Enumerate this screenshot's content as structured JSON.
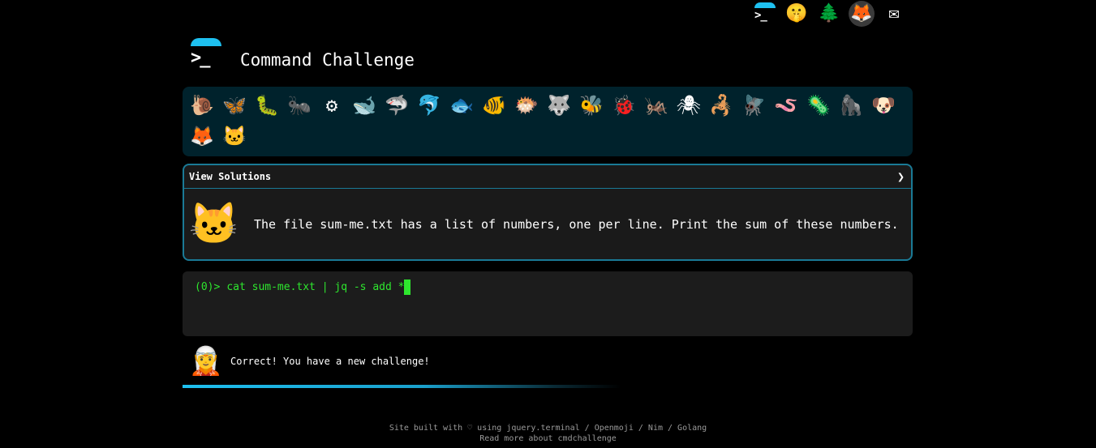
{
  "top_icons": [
    {
      "name": "cmd-logo-icon",
      "glyph": ">_"
    },
    {
      "name": "shushing-face-icon",
      "glyph": "🤫"
    },
    {
      "name": "tree-icon",
      "glyph": "🌲"
    },
    {
      "name": "gitlab-icon",
      "glyph": "🦊"
    },
    {
      "name": "mail-icon",
      "glyph": "✉"
    }
  ],
  "header": {
    "title": "Command Challenge",
    "logo_prompt": ">_"
  },
  "challenge_icons": [
    {
      "name": "snail-icon",
      "glyph": "🐌"
    },
    {
      "name": "butterfly-icon",
      "glyph": "🦋"
    },
    {
      "name": "caterpillar-icon",
      "glyph": "🐛"
    },
    {
      "name": "ant-icon",
      "glyph": "🐜"
    },
    {
      "name": "wheel-icon",
      "glyph": "⚙"
    },
    {
      "name": "whale-icon",
      "glyph": "🐋"
    },
    {
      "name": "shark-icon",
      "glyph": "🦈"
    },
    {
      "name": "dolphin-icon",
      "glyph": "🐬"
    },
    {
      "name": "fish-icon",
      "glyph": "🐟"
    },
    {
      "name": "tropical-fish-icon",
      "glyph": "🐠"
    },
    {
      "name": "pufferfish-icon",
      "glyph": "🐡"
    },
    {
      "name": "wolf-icon",
      "glyph": "🐺"
    },
    {
      "name": "bee-icon",
      "glyph": "🐝"
    },
    {
      "name": "ladybug-icon",
      "glyph": "🐞"
    },
    {
      "name": "cricket-icon",
      "glyph": "🦗"
    },
    {
      "name": "spider-icon",
      "glyph": "🕷"
    },
    {
      "name": "scorpion-icon",
      "glyph": "🦂"
    },
    {
      "name": "fly-icon",
      "glyph": "🪰"
    },
    {
      "name": "worm-icon",
      "glyph": "🪱"
    },
    {
      "name": "microbe-icon",
      "glyph": "🦠"
    },
    {
      "name": "gorilla-icon",
      "glyph": "🦍"
    },
    {
      "name": "dog-icon",
      "glyph": "🐶"
    },
    {
      "name": "fox-icon",
      "glyph": "🦊"
    },
    {
      "name": "cat-icon",
      "glyph": "🐱"
    }
  ],
  "challenge": {
    "header_label": "View Solutions",
    "chevron": "❯",
    "icon_glyph": "🐱",
    "text": "The file sum-me.txt has a list of numbers, one per line. Print the sum of these numbers."
  },
  "terminal": {
    "prompt": "(0)>",
    "command": "cat sum-me.txt | jq -s add *"
  },
  "result": {
    "icon_glyph": "🧝",
    "message": "Correct! You have a new challenge!"
  },
  "footer": {
    "line1_prefix": "Site built with ♡ using ",
    "links": [
      "jquery.terminal",
      "Openmoji",
      "Nim",
      "Golang"
    ],
    "line2": "Read more about cmdchallenge"
  },
  "colors": {
    "accent": "#1ec0f0",
    "terminal_green": "#2ee62e",
    "box_border": "#1a7a96",
    "emoji_bar_bg": "#00222c"
  }
}
